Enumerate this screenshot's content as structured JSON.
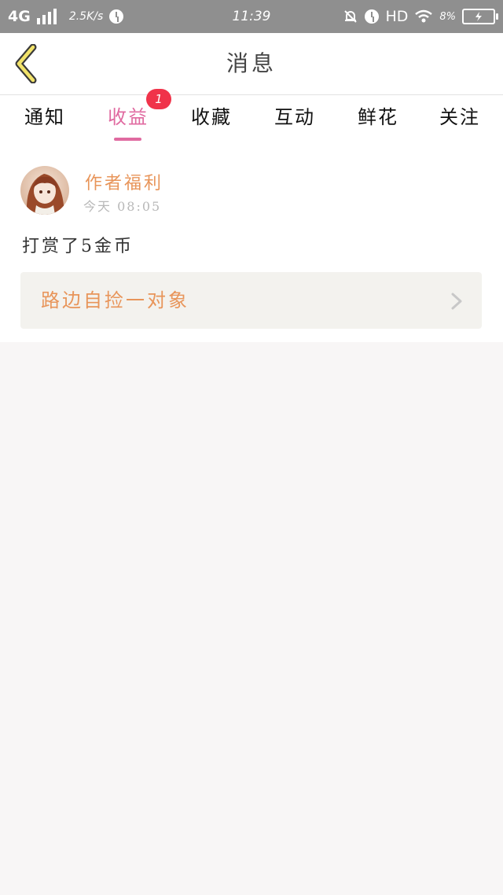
{
  "status_bar": {
    "network": "4G",
    "speed": "2.5K/s",
    "time": "11:39",
    "hd": "HD",
    "battery_percent": "8%"
  },
  "header": {
    "title": "消息"
  },
  "tabs": [
    {
      "label": "通知"
    },
    {
      "label": "收益",
      "badge": "1",
      "active": true
    },
    {
      "label": "收藏"
    },
    {
      "label": "互动"
    },
    {
      "label": "鲜花"
    },
    {
      "label": "关注"
    }
  ],
  "message": {
    "sender": "作者福利",
    "time": "今天 08:05",
    "text": "打赏了5金币",
    "link_title": "路边自捡一对象"
  },
  "colors": {
    "accent_pink": "#e06aa0",
    "accent_orange": "#e8955a",
    "badge_red": "#f0334a",
    "status_bar": "#8f8f8f"
  }
}
